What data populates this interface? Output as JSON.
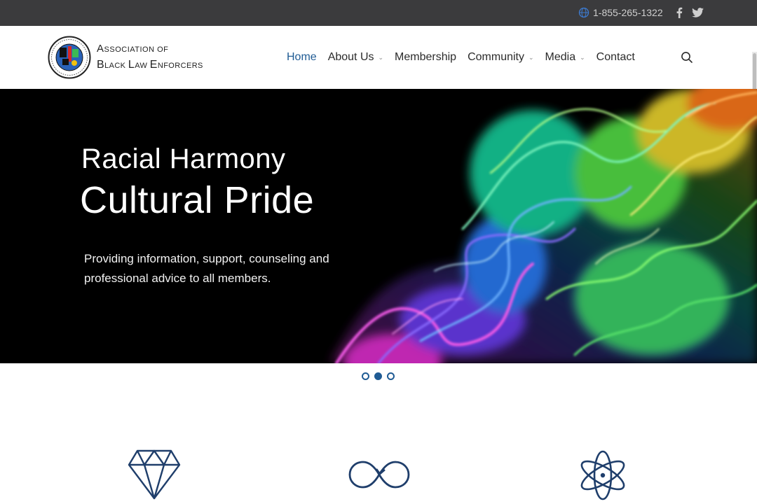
{
  "colors": {
    "accent": "#1f5b94",
    "topbar": "#3b3b3d"
  },
  "topbar": {
    "phone": "1-855-265-1322",
    "phone_icon": "globe-icon",
    "social": [
      "facebook-icon",
      "twitter-icon"
    ]
  },
  "logo": {
    "line1_big1": "A",
    "line1_small1": "SSOCIATION OF",
    "line2_big1": "B",
    "line2_small1": "LACK ",
    "line2_big2": "L",
    "line2_small2": "AW ",
    "line2_big3": "E",
    "line2_small3": "NFORCERS"
  },
  "nav": {
    "items": [
      {
        "label": "Home",
        "active": true
      },
      {
        "label": "About Us",
        "dropdown": true
      },
      {
        "label": "Membership"
      },
      {
        "label": "Community",
        "dropdown": true
      },
      {
        "label": "Media",
        "dropdown": true
      },
      {
        "label": "Contact"
      }
    ],
    "caret": "⌄",
    "search_icon": "search-icon"
  },
  "hero": {
    "title_line1": "Racial Harmony",
    "title_line2": "Cultural Pride",
    "description": "Providing information, support, counseling and professional advice to all members."
  },
  "slider": {
    "count": 3,
    "active_index": 1
  },
  "features": [
    "diamond-icon",
    "infinity-icon",
    "atom-icon"
  ]
}
